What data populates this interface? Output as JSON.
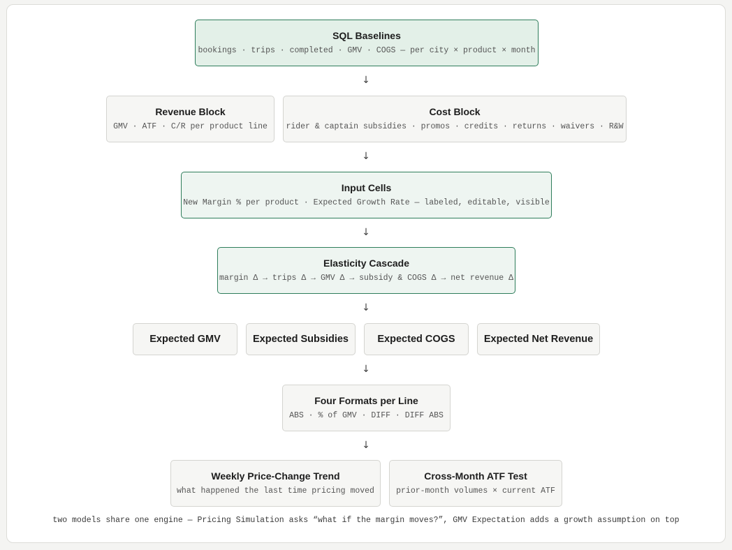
{
  "arrow_glyph": "↓",
  "sql_baselines": {
    "title": "SQL Baselines",
    "subtitle": "bookings · trips · completed · GMV · COGS — per city × product × month"
  },
  "revenue_block": {
    "title": "Revenue Block",
    "subtitle": "GMV · ATF · C/R per product line"
  },
  "cost_block": {
    "title": "Cost Block",
    "subtitle": "rider & captain subsidies · promos · credits · returns · waivers · R&W"
  },
  "input_cells": {
    "title": "Input Cells",
    "subtitle": "New Margin % per product · Expected Growth Rate — labeled, editable, visible"
  },
  "elasticity_cascade": {
    "title": "Elasticity Cascade",
    "subtitle": "margin Δ → trips Δ → GMV Δ → subsidy & COGS Δ → net revenue Δ"
  },
  "outputs": {
    "gmv": "Expected GMV",
    "subsidies": "Expected Subsidies",
    "cogs": "Expected COGS",
    "net_revenue": "Expected Net Revenue"
  },
  "four_formats": {
    "title": "Four Formats per Line",
    "subtitle": "ABS · % of GMV · DIFF · DIFF ABS"
  },
  "weekly_trend": {
    "title": "Weekly Price-Change Trend",
    "subtitle": "what happened the last time pricing moved"
  },
  "atf_test": {
    "title": "Cross-Month ATF Test",
    "subtitle": "prior-month volumes × current ATF"
  },
  "caption": "two models share one engine — Pricing Simulation asks “what if the margin moves?”, GMV Expectation adds a growth assumption on top",
  "colors": {
    "accent_border": "#2e7d5b",
    "accent_fill": "#e3f0e8",
    "node_fill": "#f6f6f4",
    "node_border": "#d4d4d0"
  }
}
